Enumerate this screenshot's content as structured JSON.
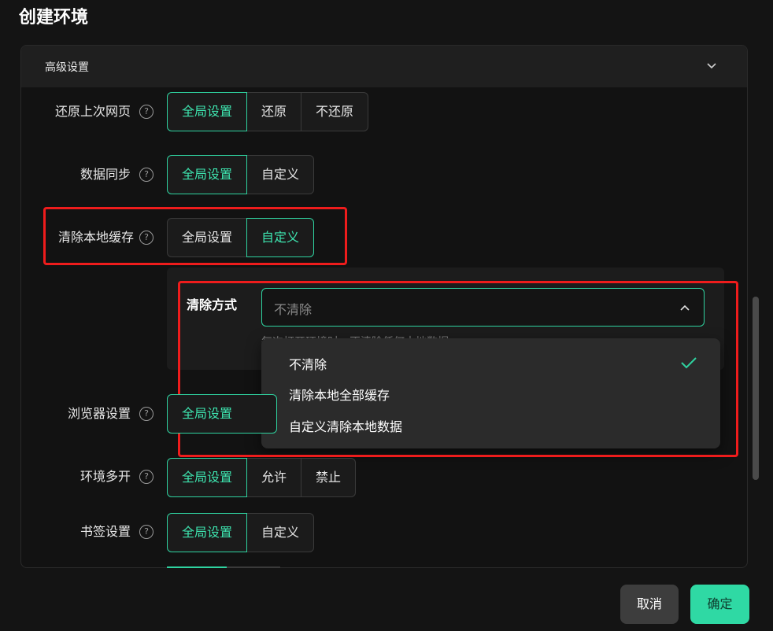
{
  "page": {
    "title": "创建环境"
  },
  "panel": {
    "title": "高级设置"
  },
  "rows": [
    {
      "label": "还原上次网页",
      "options": [
        "全局设置",
        "还原",
        "不还原"
      ]
    },
    {
      "label": "数据同步",
      "options": [
        "全局设置",
        "自定义"
      ]
    },
    {
      "label": "清除本地缓存",
      "options": [
        "全局设置",
        "自定义"
      ]
    },
    {
      "label": "浏览器设置",
      "options": [
        "全局设置"
      ]
    },
    {
      "label": "环境多开",
      "options": [
        "全局设置",
        "允许",
        "禁止"
      ]
    },
    {
      "label": "书签设置",
      "options": [
        "全局设置",
        "自定义"
      ]
    }
  ],
  "clear_cache": {
    "label": "清除方式",
    "selected": "不清除",
    "hint": "每次打开环境时，不清除任何本地数据",
    "options": [
      "不清除",
      "清除本地全部缓存",
      "自定义清除本地数据"
    ]
  },
  "footer": {
    "cancel": "取消",
    "ok": "确定"
  },
  "colors": {
    "accent": "#2fd3a0",
    "highlight": "#ee1c1c",
    "background": "#141414"
  }
}
